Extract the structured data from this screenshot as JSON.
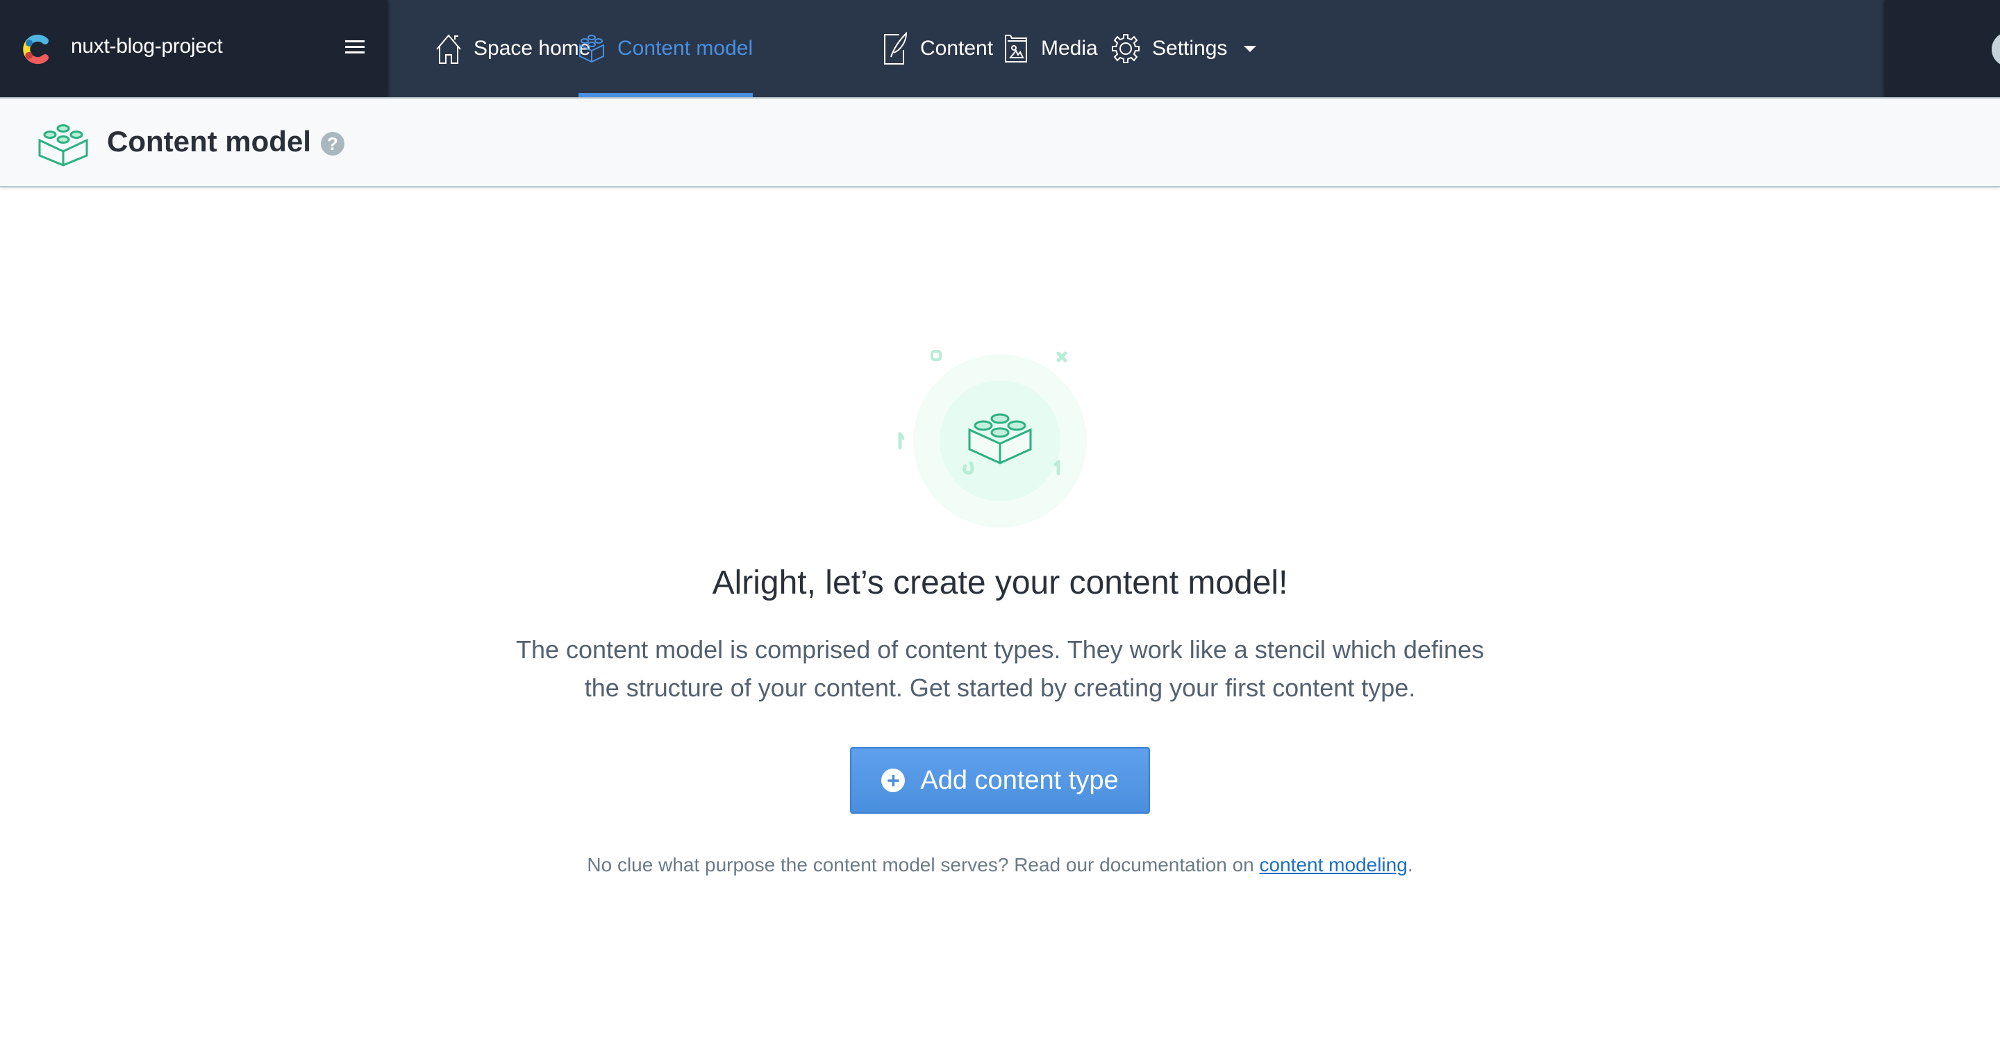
{
  "topbar": {
    "space_name": "nuxt-blog-project",
    "nav": [
      {
        "label": "Space home",
        "icon": "home-icon",
        "active": false
      },
      {
        "label": "Content model",
        "icon": "content-model-icon",
        "active": true
      },
      {
        "label": "Content",
        "icon": "content-icon",
        "active": false
      },
      {
        "label": "Media",
        "icon": "media-icon",
        "active": false
      },
      {
        "label": "Settings",
        "icon": "gear-icon",
        "active": false,
        "has_dropdown": true
      }
    ]
  },
  "header": {
    "title": "Content model",
    "help": "?"
  },
  "empty_state": {
    "headline": "Alright, let’s create your content model!",
    "description": "The content model is comprised of content types. They work like a stencil which defines the structure of your content. Get started by creating your first content type.",
    "button_label": "Add content type",
    "footnote_prefix": "No clue what purpose the content model serves? Read our documentation on ",
    "footnote_link": "content modeling",
    "footnote_suffix": "."
  },
  "colors": {
    "accent": "#4a90e2",
    "brand_green": "#2bb181",
    "nav_bg": "#2a3649",
    "nav_dark": "#1c2431"
  }
}
